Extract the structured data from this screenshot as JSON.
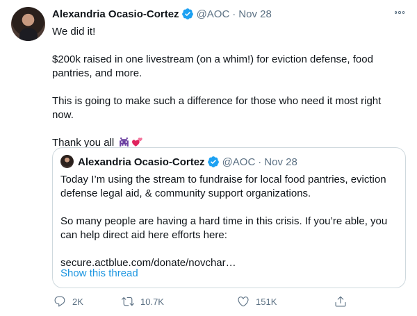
{
  "tweet": {
    "author_name": "Alexandria Ocasio-Cortez",
    "handle": "@AOC",
    "separator": "·",
    "date": "Nov 28",
    "paragraphs": [
      "We did it!",
      "$200k raised in one livestream (on a whim!) for eviction defense, food pantries, and more.",
      "This is going to make such a difference for those who need it most right now.",
      "Thank you all"
    ],
    "emojis": [
      "alien-monster-emoji",
      "two-hearts-emoji"
    ]
  },
  "quote": {
    "author_name": "Alexandria Ocasio-Cortez",
    "handle": "@AOC",
    "separator": "·",
    "date": "Nov 28",
    "paragraphs": [
      "Today I’m using the stream to fundraise for local food pantries, eviction defense legal aid, & community support organizations.",
      "So many people are having a hard time in this crisis. If you’re able, you can help direct aid here efforts here:",
      "secure.actblue.com/donate/novchar…"
    ],
    "show_thread": "Show this thread"
  },
  "actions": {
    "reply_count": "2K",
    "retweet_count": "10.7K",
    "like_count": "151K"
  },
  "colors": {
    "accent": "#1b95e0",
    "verified": "#1da1f2",
    "muted": "#5b7083",
    "border": "#cfd9de"
  }
}
